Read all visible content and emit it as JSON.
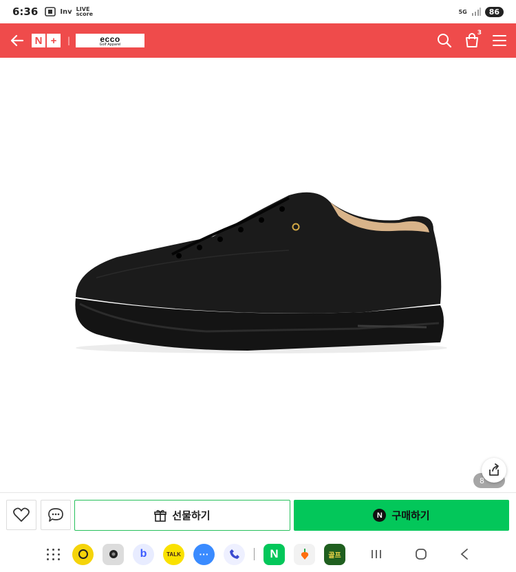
{
  "status_bar": {
    "time": "6:36",
    "left_icons": [
      "screenshot-icon",
      "inv-icon",
      "livescore-icon"
    ],
    "right_icons": [
      "5g-icon",
      "signal-icon"
    ],
    "battery": "86"
  },
  "header": {
    "background_color": "#ef4b4b",
    "nplus_letters": [
      "N",
      "+"
    ],
    "brand_name": "ecco",
    "brand_sub": "Golf Apparel",
    "cart_count": "3"
  },
  "product": {
    "image": "black-leather-golf-shoe",
    "image_counter": "8"
  },
  "actions": {
    "gift_label": "선물하기",
    "buy_label": "구매하기",
    "npay_letter": "N",
    "buy_color": "#03c75a"
  },
  "dock": {
    "apps": [
      "yellow-sync-app",
      "camera-app",
      "bixby-app",
      "kakaotalk-app",
      "messages-app",
      "phone-app",
      "naver-app",
      "carrot-app",
      "golf-app"
    ],
    "kakao_text": "TALK",
    "naver_letter": "N",
    "golf_text": "골프"
  }
}
